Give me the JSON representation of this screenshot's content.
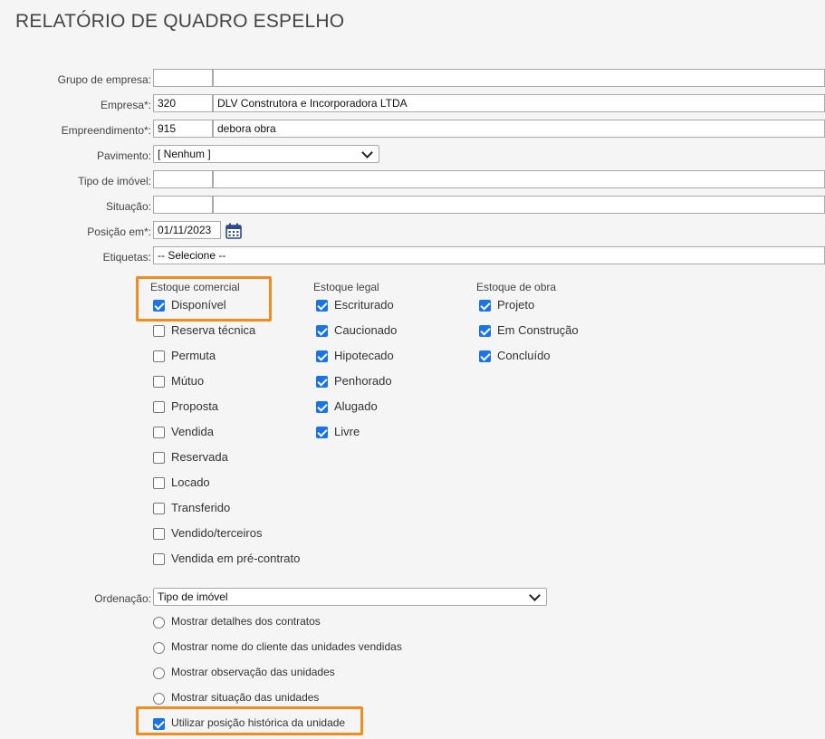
{
  "page": {
    "title": "RELATÓRIO DE QUADRO ESPELHO"
  },
  "form": {
    "grupo_label": "Grupo de empresa:",
    "grupo_code": "",
    "grupo_name": "",
    "empresa_label": "Empresa*:",
    "empresa_code": "320",
    "empresa_name": "DLV Construtora e Incorporadora LTDA",
    "empreendimento_label": "Empreendimento*:",
    "empreendimento_code": "915",
    "empreendimento_name": "debora obra",
    "pavimento_label": "Pavimento:",
    "pavimento_value": "[ Nenhum ]",
    "tipo_label": "Tipo de imóvel:",
    "tipo_code": "",
    "tipo_name": "",
    "situacao_label": "Situação:",
    "situacao_code": "",
    "situacao_name": "",
    "posicao_label": "Posição em*:",
    "posicao_value": "01/11/2023",
    "etiquetas_label": "Etiquetas:",
    "etiquetas_value": "-- Selecione --"
  },
  "estoque_comercial": {
    "header": "Estoque comercial",
    "items": [
      {
        "label": "Disponível",
        "checked": true
      },
      {
        "label": "Reserva técnica",
        "checked": false
      },
      {
        "label": "Permuta",
        "checked": false
      },
      {
        "label": "Mútuo",
        "checked": false
      },
      {
        "label": "Proposta",
        "checked": false
      },
      {
        "label": "Vendida",
        "checked": false
      },
      {
        "label": "Reservada",
        "checked": false
      },
      {
        "label": "Locado",
        "checked": false
      },
      {
        "label": "Transferido",
        "checked": false
      },
      {
        "label": "Vendido/terceiros",
        "checked": false
      },
      {
        "label": "Vendida em pré-contrato",
        "checked": false
      }
    ]
  },
  "estoque_legal": {
    "header": "Estoque legal",
    "items": [
      {
        "label": "Escriturado",
        "checked": true
      },
      {
        "label": "Caucionado",
        "checked": true
      },
      {
        "label": "Hipotecado",
        "checked": true
      },
      {
        "label": "Penhorado",
        "checked": true
      },
      {
        "label": "Alugado",
        "checked": true
      },
      {
        "label": "Livre",
        "checked": true
      }
    ]
  },
  "estoque_obra": {
    "header": "Estoque de obra",
    "items": [
      {
        "label": "Projeto",
        "checked": true
      },
      {
        "label": "Em Construção",
        "checked": true
      },
      {
        "label": "Concluído",
        "checked": true
      }
    ]
  },
  "ordenacao": {
    "label": "Ordenação:",
    "value": "Tipo de imóvel"
  },
  "options": {
    "radios": [
      "Mostrar detalhes dos contratos",
      "Mostrar nome do cliente das unidades vendidas",
      "Mostrar observação das unidades",
      "Mostrar situação das unidades"
    ],
    "historica_label": "Utilizar posição histórica da unidade",
    "historica_checked": true
  },
  "colors": {
    "highlight": "#f28c1e",
    "checkbox_accent": "#1a73e8",
    "calendar_icon": "#2b4a8b"
  },
  "icons": {
    "calendar": "calendar-icon",
    "dropdown": "chevron-down-icon"
  }
}
